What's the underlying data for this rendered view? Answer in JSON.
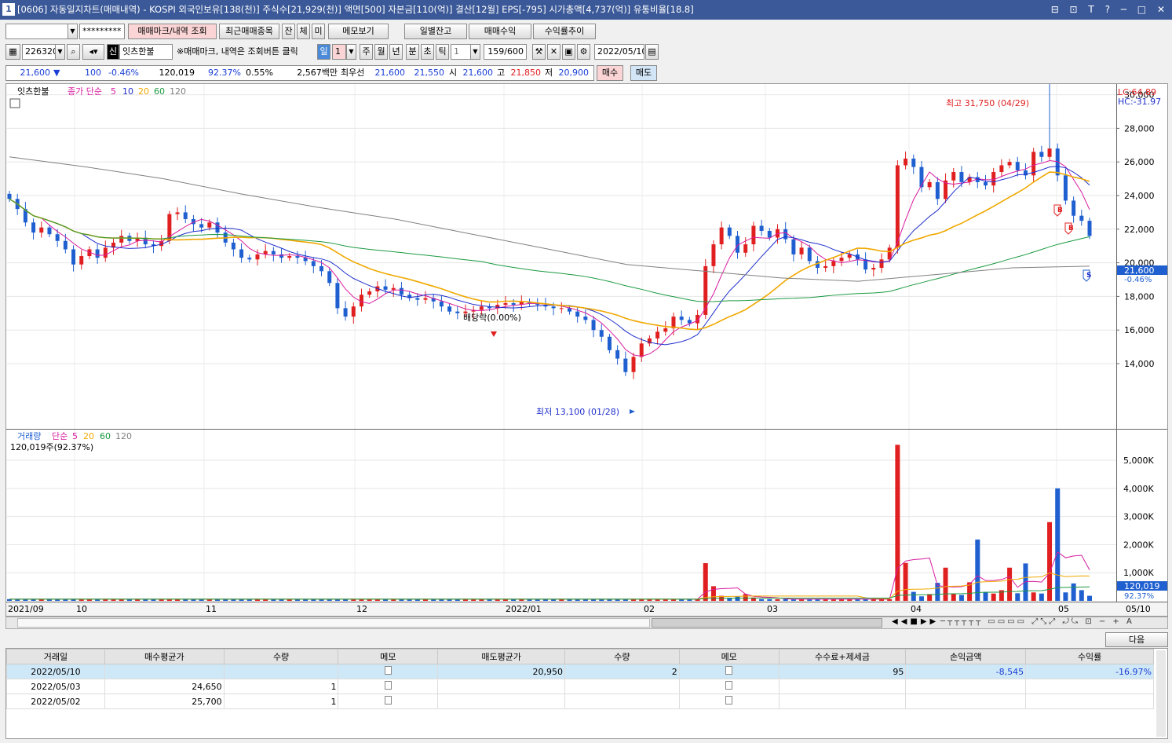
{
  "window": {
    "number": "1",
    "title": "[0606] 자동일지차트(매매내역) - KOSPI 외국인보유[138(천)] 주식수[21,929(천)] 액면[500] 자본금[110(억)] 결산[12월] EPS[-795] 시가총액[4,737(억)] 유통비율[18.8]",
    "controls": "⊟ ⊡ T ? ─ □ ✕"
  },
  "toolbar1": {
    "account": "",
    "password": "*********",
    "btn_markers": "매매마크/내역 조회",
    "btn_recent": "최근매매종목",
    "btn_jan": "잔",
    "btn_che": "체",
    "btn_mi": "미",
    "btn_memo": "메모보기",
    "btn_daily": "일별잔고",
    "btn_profit": "매매수익",
    "btn_trend": "수익률추이"
  },
  "toolbar2": {
    "code": "226320",
    "sin": "신",
    "name": "잇츠한불",
    "hint": "※매매마크, 내역은 조회버튼 클릭",
    "periods": [
      "일",
      "1",
      "주",
      "월",
      "년",
      "분",
      "초",
      "틱",
      "1"
    ],
    "count": "159/600",
    "date": "2022/05/10"
  },
  "quote": {
    "price": "21,600",
    "arrow": "▼",
    "change": "100",
    "change_pct": "-0.46%",
    "volume": "120,019",
    "vol_pct": "92.37%",
    "turnover": "0.55%",
    "amount": "2,567백만",
    "pref_label": "최우선",
    "pref_ask": "21,600",
    "pref_bid": "21,550",
    "open_label": "시",
    "open": "21,600",
    "high_label": "고",
    "high": "21,850",
    "low_label": "저",
    "low": "20,900",
    "buy": "매수",
    "sell": "매도"
  },
  "legend": {
    "name": "잇츠한불",
    "ma_label": "종가 단순",
    "ma5": "5",
    "ma10": "10",
    "ma20": "20",
    "ma60": "60",
    "ma120": "120",
    "vol_label": "거래량",
    "vol_ma_label": "단순",
    "vmaA": "5",
    "vmaB": "20",
    "vmaC": "60",
    "vmaD": "120",
    "vol_info": "120,019주(92.37%)",
    "lc": "LC:64.89",
    "hc": "HC:-31.97"
  },
  "annotations": {
    "high": "최고 31,750 (04/29)",
    "low": "최저 13,100 (01/28)",
    "dividend": "배당락(0.00%)",
    "price_tag": "21,600",
    "pct_tag": "-0.46%",
    "vol_tag": "120,019",
    "vol_pct_tag": "92.37%",
    "marker_b": "B",
    "marker_s": "S"
  },
  "colors": {
    "up": "#e02020",
    "down": "#1f5fd0",
    "ma5": "#d81b9e",
    "ma10": "#1f2fcc",
    "ma20": "#f0a800",
    "ma60": "#1a9a40",
    "ma120": "#808080"
  },
  "chart_data": {
    "type": "candlestick",
    "price_axis": {
      "ticks": [
        14000,
        16000,
        18000,
        20000,
        22000,
        24000,
        26000,
        28000,
        30000
      ]
    },
    "volume_axis": {
      "ticks": [
        "1,000K",
        "2,000K",
        "3,000K",
        "4,000K",
        "5,000K"
      ]
    },
    "x_labels": [
      "2021/09",
      "10",
      "11",
      "12",
      "2022/01",
      "02",
      "03",
      "04",
      "05",
      "05/10"
    ],
    "close_path": [
      23800,
      23200,
      22400,
      21800,
      22100,
      21700,
      21300,
      20800,
      19900,
      20400,
      20800,
      20300,
      20900,
      21200,
      21600,
      21300,
      21500,
      21100,
      21000,
      21300,
      22900,
      23000,
      22600,
      22300,
      22100,
      22400,
      21800,
      21200,
      20800,
      20300,
      20200,
      20500,
      20700,
      20500,
      20300,
      20400,
      20300,
      20100,
      19800,
      19500,
      18800,
      17300,
      16800,
      17400,
      18100,
      18300,
      18600,
      18400,
      18500,
      18100,
      17900,
      17800,
      17900,
      17700,
      17400,
      17100,
      17000,
      17100,
      17200,
      17400,
      17300,
      17500,
      17600,
      17500,
      17700,
      17600,
      17500,
      17400,
      17300,
      17300,
      17100,
      16800,
      16600,
      16000,
      15600,
      14800,
      14300,
      13500,
      14400,
      15200,
      15500,
      15900,
      16100,
      16800,
      16600,
      16400,
      16900,
      19800,
      21100,
      22100,
      21600,
      20600,
      21100,
      22200,
      21900,
      21500,
      22000,
      21400,
      20500,
      20900,
      20100,
      19700,
      19800,
      20100,
      20300,
      20500,
      20200,
      19600,
      19700,
      20200,
      20900,
      25800,
      26200,
      25700,
      24500,
      24800,
      23800,
      24900,
      25400,
      24800,
      25100,
      24800,
      24600,
      25400,
      25800,
      26000,
      25500,
      25200,
      26600,
      26300,
      26800,
      25200,
      23700,
      22800,
      22500,
      21600
    ],
    "ma120_path": [
      26300,
      25700,
      25000,
      24100,
      23300,
      22600,
      21700,
      20800,
      19900,
      19500,
      19100,
      18900,
      19300,
      19700,
      19800
    ]
  }
}
